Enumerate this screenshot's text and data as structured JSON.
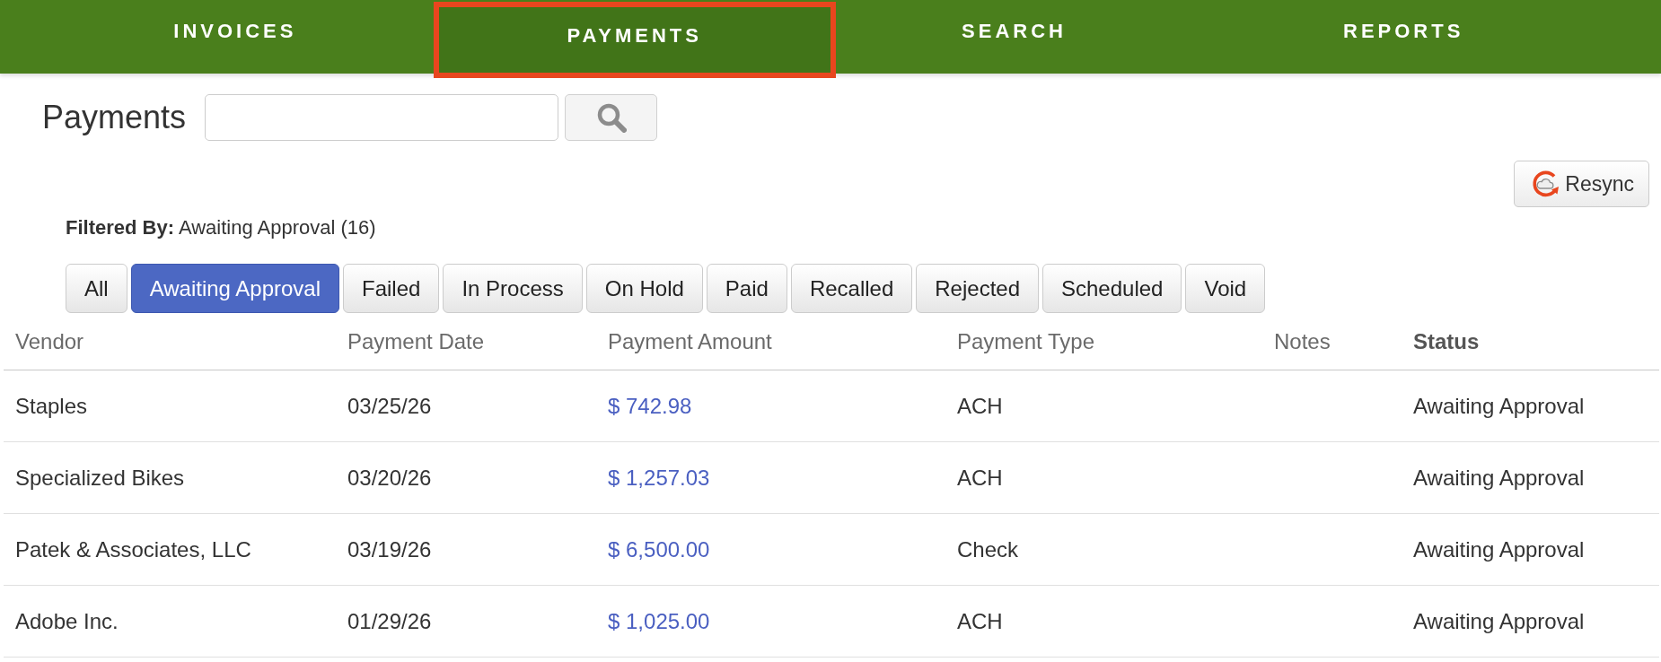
{
  "nav": {
    "tabs": [
      {
        "label": "INVOICES",
        "selected": false
      },
      {
        "label": "PAYMENTS",
        "selected": true
      },
      {
        "label": "SEARCH",
        "selected": false
      },
      {
        "label": "REPORTS",
        "selected": false
      }
    ]
  },
  "page": {
    "title": "Payments"
  },
  "resync_button": {
    "label": "Resync"
  },
  "filter_summary": "**Filtered By:** Awaiting Approval (16)",
  "filters": [
    {
      "label": "All",
      "selected": false
    },
    {
      "label": "Awaiting Approval",
      "selected": true
    },
    {
      "label": "Failed",
      "selected": false
    },
    {
      "label": "In Process",
      "selected": false
    },
    {
      "label": "On Hold",
      "selected": false
    },
    {
      "label": "Paid",
      "selected": false
    },
    {
      "label": "Recalled",
      "selected": false
    },
    {
      "label": "Rejected",
      "selected": false
    },
    {
      "label": "Scheduled",
      "selected": false
    },
    {
      "label": "Void",
      "selected": false
    }
  ],
  "table": {
    "columns": [
      {
        "label": "Vendor",
        "sorted": false
      },
      {
        "label": "Payment Date",
        "sorted": false
      },
      {
        "label": "Payment Amount",
        "sorted": false
      },
      {
        "label": "Payment Type",
        "sorted": false
      },
      {
        "label": "Notes",
        "sorted": false
      },
      {
        "label": "Status",
        "sorted": true
      }
    ],
    "rows": [
      {
        "vendor": "Staples",
        "payment_date": "03/25/26",
        "payment_amount": "$ 742.98",
        "payment_type": "ACH",
        "status": "Awaiting Approval"
      },
      {
        "vendor": "Specialized Bikes",
        "payment_date": "03/20/26",
        "payment_amount": "$ 1,257.03",
        "payment_type": "ACH",
        "status": "Awaiting Approval"
      },
      {
        "vendor": "Patek & Associates, LLC",
        "payment_date": "03/19/26",
        "payment_amount": "$ 6,500.00",
        "payment_type": "Check",
        "status": "Awaiting Approval"
      },
      {
        "vendor": "Adobe Inc.",
        "payment_date": "01/29/26",
        "payment_amount": "$ 1,025.00",
        "payment_type": "ACH",
        "status": "Awaiting Approval"
      }
    ]
  }
}
